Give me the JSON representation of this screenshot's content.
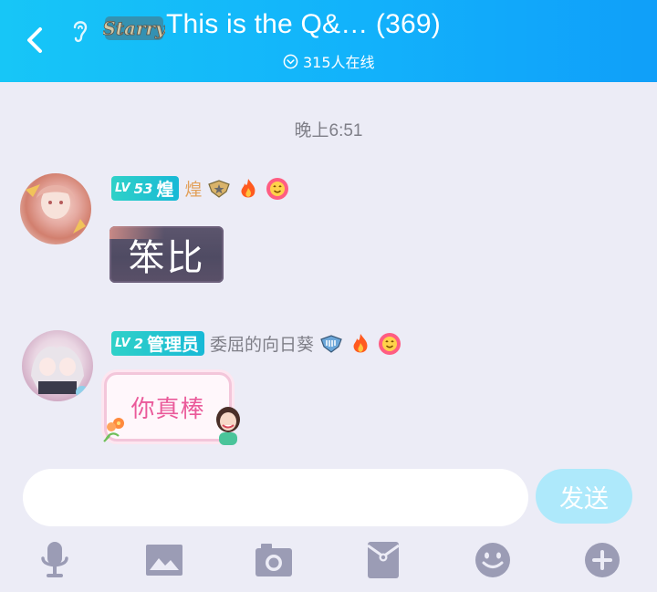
{
  "header": {
    "title": "This is the Q&… (369)",
    "badge_text": "Starry",
    "online_count": "315人在线"
  },
  "chat": {
    "timestamp": "晚上6:51",
    "messages": [
      {
        "level_prefix": "LV",
        "level": "53",
        "level_name": "煌",
        "username": "煌",
        "text": "笨比"
      },
      {
        "level_prefix": "LV",
        "level": "2",
        "level_name": "管理员",
        "username": "委屈的向日葵",
        "text": "你真棒"
      }
    ]
  },
  "composer": {
    "placeholder": "",
    "value": "",
    "send_label": "发送"
  },
  "toolbar": {
    "items": [
      "microphone-icon",
      "image-icon",
      "camera-icon",
      "red-packet-icon",
      "emoji-icon",
      "plus-icon"
    ]
  },
  "colors": {
    "header_start": "#17c6f7",
    "header_end": "#109ff9",
    "level_badge": "#2fd1c8",
    "send_button": "#aee9fb",
    "icon_gray": "#9b9cb5",
    "background": "#ececf6"
  }
}
